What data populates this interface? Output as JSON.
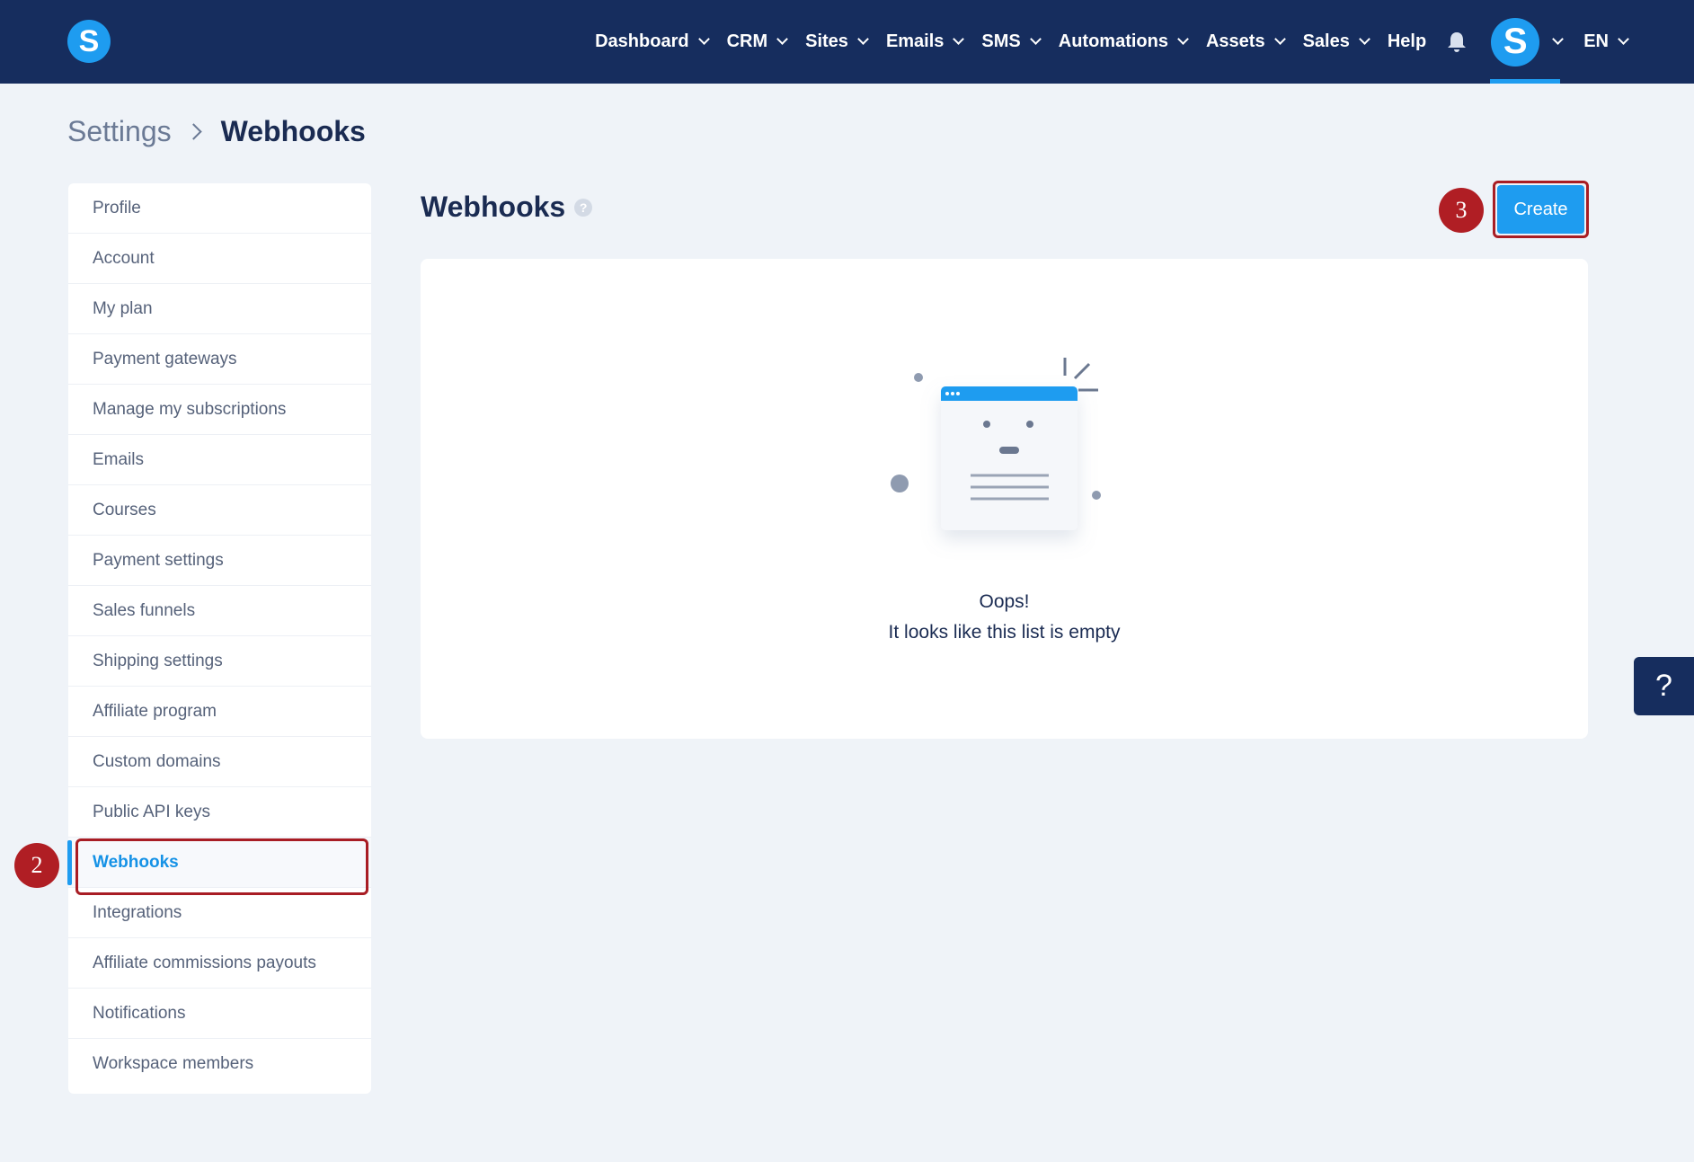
{
  "header": {
    "logo_letter": "S",
    "nav": [
      {
        "label": "Dashboard",
        "has_dropdown": true
      },
      {
        "label": "CRM",
        "has_dropdown": true
      },
      {
        "label": "Sites",
        "has_dropdown": true
      },
      {
        "label": "Emails",
        "has_dropdown": true
      },
      {
        "label": "SMS",
        "has_dropdown": true
      },
      {
        "label": "Automations",
        "has_dropdown": true
      },
      {
        "label": "Assets",
        "has_dropdown": true
      },
      {
        "label": "Sales",
        "has_dropdown": true
      },
      {
        "label": "Help",
        "has_dropdown": false
      }
    ],
    "bell_icon": "bell-icon",
    "avatar_letter": "S",
    "language": "EN",
    "colors": {
      "bar": "#162d5e",
      "accent": "#1e9cf0"
    }
  },
  "breadcrumb": {
    "root": "Settings",
    "current": "Webhooks"
  },
  "sidebar": {
    "items": [
      {
        "label": "Profile"
      },
      {
        "label": "Account"
      },
      {
        "label": "My plan"
      },
      {
        "label": "Payment gateways"
      },
      {
        "label": "Manage my subscriptions"
      },
      {
        "label": "Emails"
      },
      {
        "label": "Courses"
      },
      {
        "label": "Payment settings"
      },
      {
        "label": "Sales funnels"
      },
      {
        "label": "Shipping settings"
      },
      {
        "label": "Affiliate program"
      },
      {
        "label": "Custom domains"
      },
      {
        "label": "Public API keys"
      },
      {
        "label": "Webhooks",
        "active": true
      },
      {
        "label": "Integrations"
      },
      {
        "label": "Affiliate commissions payouts"
      },
      {
        "label": "Notifications"
      },
      {
        "label": "Workspace members"
      }
    ]
  },
  "main": {
    "title": "Webhooks",
    "help_glyph": "?",
    "create_label": "Create",
    "empty": {
      "line1": "Oops!",
      "line2": "It looks like this list is empty"
    }
  },
  "annotations": {
    "step2": "2",
    "step3": "3",
    "color": "#b01e24"
  },
  "floating_help": "?"
}
